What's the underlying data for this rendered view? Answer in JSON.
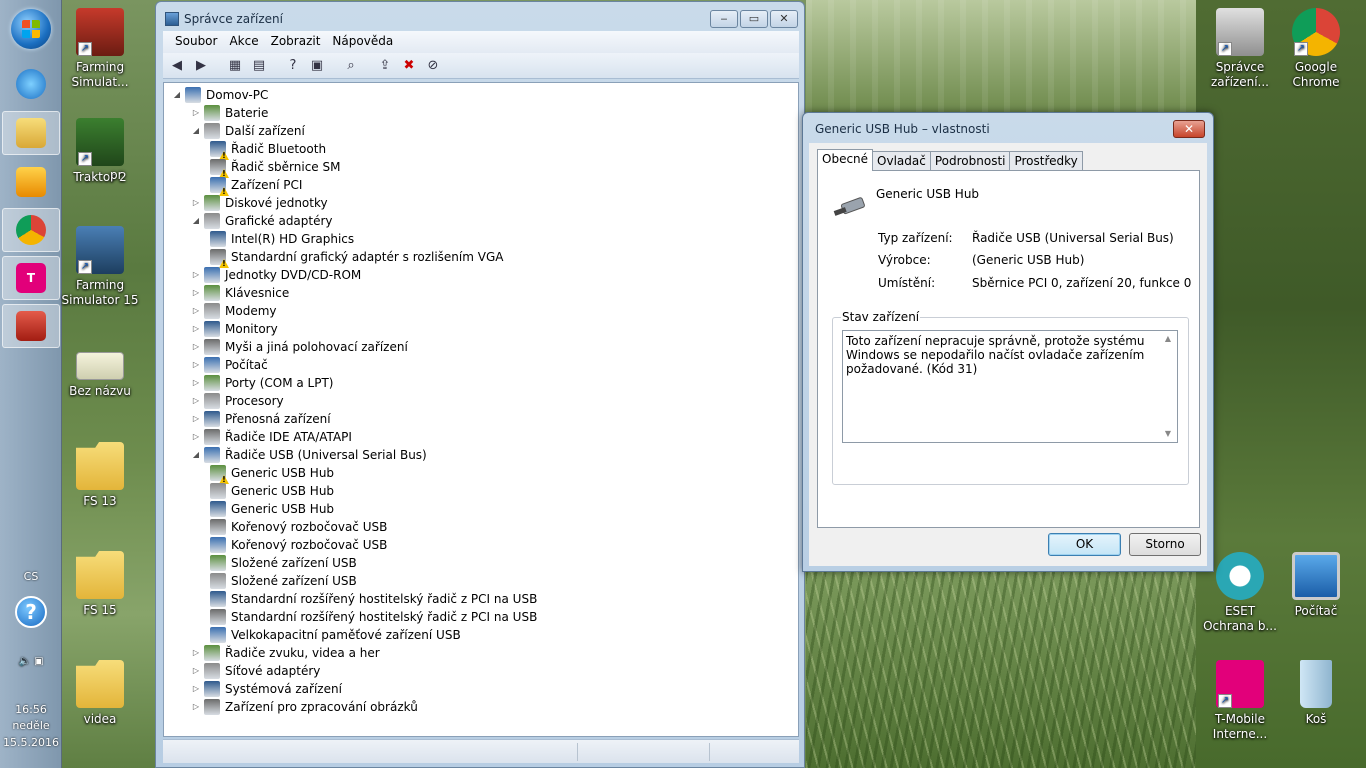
{
  "desktop": {
    "icons_left": [
      {
        "label": "Farming Simulat...",
        "icon": "farming-simulator-icon"
      },
      {
        "label": "Traktor 2",
        "icon": "tractor-icon"
      },
      {
        "label": "pr",
        "icon": "partial-icon"
      },
      {
        "label": "Farming Simulator 15",
        "icon": "farming-simulator-15-icon"
      },
      {
        "label": "Bez názvu",
        "icon": "image-file-icon"
      },
      {
        "label": "FS 13",
        "icon": "folder-icon"
      },
      {
        "label": "FS 15",
        "icon": "folder-icon"
      },
      {
        "label": "videa",
        "icon": "folder-icon"
      }
    ],
    "icons_right": [
      {
        "label": "Správce zařízení...",
        "icon": "device-manager-icon"
      },
      {
        "label": "Google Chrome",
        "icon": "chrome-icon"
      },
      {
        "label": "ESET Ochrana b...",
        "icon": "eset-icon"
      },
      {
        "label": "Počítač",
        "icon": "computer-icon"
      },
      {
        "label": "T-Mobile Interne...",
        "icon": "t-mobile-icon"
      },
      {
        "label": "Koš",
        "icon": "recycle-bin-icon"
      }
    ]
  },
  "taskbar": {
    "language": "CS",
    "time": "16:56",
    "day": "neděle",
    "date": "15.5.2016"
  },
  "device_manager": {
    "title": "Správce zařízení",
    "menu": [
      "Soubor",
      "Akce",
      "Zobrazit",
      "Nápověda"
    ],
    "tree": [
      {
        "label": "Domov-PC",
        "level": 0,
        "expanded": true
      },
      {
        "label": "Baterie",
        "level": 1
      },
      {
        "label": "Další zařízení",
        "level": 1,
        "expanded": true
      },
      {
        "label": "Řadič Bluetooth",
        "level": 2,
        "warning": true
      },
      {
        "label": "Řadič sběrnice SM",
        "level": 2,
        "warning": true
      },
      {
        "label": "Zařízení PCI",
        "level": 2,
        "warning": true
      },
      {
        "label": "Diskové jednotky",
        "level": 1
      },
      {
        "label": "Grafické adaptéry",
        "level": 1,
        "expanded": true
      },
      {
        "label": "Intel(R) HD Graphics",
        "level": 2
      },
      {
        "label": "Standardní grafický adaptér s rozlišením VGA",
        "level": 2,
        "warning": true
      },
      {
        "label": "Jednotky DVD/CD-ROM",
        "level": 1
      },
      {
        "label": "Klávesnice",
        "level": 1
      },
      {
        "label": "Modemy",
        "level": 1
      },
      {
        "label": "Monitory",
        "level": 1
      },
      {
        "label": "Myši a jiná polohovací zařízení",
        "level": 1
      },
      {
        "label": "Počítač",
        "level": 1
      },
      {
        "label": "Porty (COM a LPT)",
        "level": 1
      },
      {
        "label": "Procesory",
        "level": 1
      },
      {
        "label": "Přenosná zařízení",
        "level": 1
      },
      {
        "label": "Řadiče IDE ATA/ATAPI",
        "level": 1
      },
      {
        "label": "Řadiče USB (Universal Serial Bus)",
        "level": 1,
        "expanded": true
      },
      {
        "label": "Generic USB Hub",
        "level": 2,
        "warning": true
      },
      {
        "label": "Generic USB Hub",
        "level": 2
      },
      {
        "label": "Generic USB Hub",
        "level": 2
      },
      {
        "label": "Kořenový rozbočovač USB",
        "level": 2
      },
      {
        "label": "Kořenový rozbočovač USB",
        "level": 2
      },
      {
        "label": "Složené zařízení USB",
        "level": 2
      },
      {
        "label": "Složené zařízení USB",
        "level": 2
      },
      {
        "label": "Standardní rozšířený hostitelský řadič z PCI na USB",
        "level": 2
      },
      {
        "label": "Standardní rozšířený hostitelský řadič z PCI na USB",
        "level": 2
      },
      {
        "label": "Velkokapacitní paměťové zařízení USB",
        "level": 2
      },
      {
        "label": "Řadiče zvuku, videa a her",
        "level": 1
      },
      {
        "label": "Síťové adaptéry",
        "level": 1
      },
      {
        "label": "Systémová zařízení",
        "level": 1
      },
      {
        "label": "Zařízení pro zpracování obrázků",
        "level": 1
      }
    ]
  },
  "properties_dialog": {
    "title": "Generic USB Hub – vlastnosti",
    "tabs": [
      "Obecné",
      "Ovladač",
      "Podrobnosti",
      "Prostředky"
    ],
    "device_name": "Generic USB Hub",
    "fields": {
      "type_label": "Typ zařízení:",
      "type_value": "Řadiče USB (Universal Serial Bus)",
      "vendor_label": "Výrobce:",
      "vendor_value": "(Generic USB Hub)",
      "location_label": "Umístění:",
      "location_value": "Sběrnice PCI 0, zařízení 20, funkce 0"
    },
    "status_group_label": "Stav zařízení",
    "status_text": "Toto zařízení nepracuje správně, protože systému Windows se nepodařilo načíst ovladače zařízením požadované. (Kód 31)",
    "ok_label": "OK",
    "cancel_label": "Storno"
  },
  "colors": {
    "warning": "#f5c400",
    "title_bar": "#c9daea",
    "close_button": "#c7442a"
  }
}
